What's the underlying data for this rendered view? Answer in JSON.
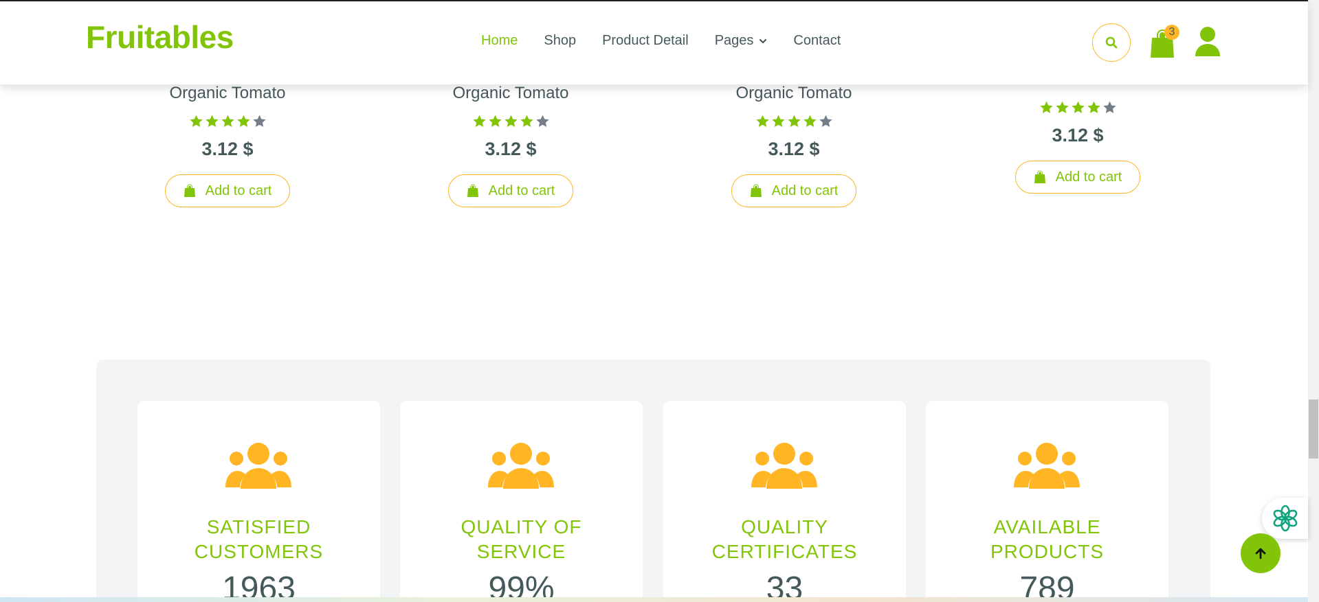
{
  "brand": {
    "logo": "Fruitables",
    "accent": "#81c408",
    "secondary": "#ffb524",
    "text": "#45595b"
  },
  "nav": {
    "items": [
      {
        "label": "Home",
        "active": true
      },
      {
        "label": "Shop",
        "active": false
      },
      {
        "label": "Product Detail",
        "active": false
      },
      {
        "label": "Pages",
        "active": false,
        "dropdown": true
      },
      {
        "label": "Contact",
        "active": false
      }
    ],
    "cart_count": "3",
    "icons": {
      "search": "search-icon",
      "cart": "shopping-bag-icon",
      "user": "user-icon",
      "pages_chevron": "chevron-down-icon"
    }
  },
  "products": [
    {
      "name": "Organic Tomato",
      "rating": 4,
      "rating_max": 5,
      "price": "3.12 $",
      "button": "Add to cart"
    },
    {
      "name": "Organic Tomato",
      "rating": 4,
      "rating_max": 5,
      "price": "3.12 $",
      "button": "Add to cart"
    },
    {
      "name": "Organic Tomato",
      "rating": 4,
      "rating_max": 5,
      "price": "3.12 $",
      "button": "Add to cart"
    },
    {
      "name": "",
      "rating": 4,
      "rating_max": 5,
      "price": "3.12 $",
      "button": "Add to cart"
    }
  ],
  "features": [
    {
      "title": "SATISFIED CUSTOMERS",
      "value": "1963",
      "icon": "users-icon"
    },
    {
      "title": "QUALITY OF SERVICE",
      "value": "99%",
      "icon": "users-icon"
    },
    {
      "title": "QUALITY CERTIFICATES",
      "value": "33",
      "icon": "users-icon"
    },
    {
      "title": "AVAILABLE PRODUCTS",
      "value": "789",
      "icon": "users-icon"
    }
  ],
  "floating": {
    "back_to_top": "arrow-up-icon",
    "assistant": "assistant-flower-icon"
  }
}
